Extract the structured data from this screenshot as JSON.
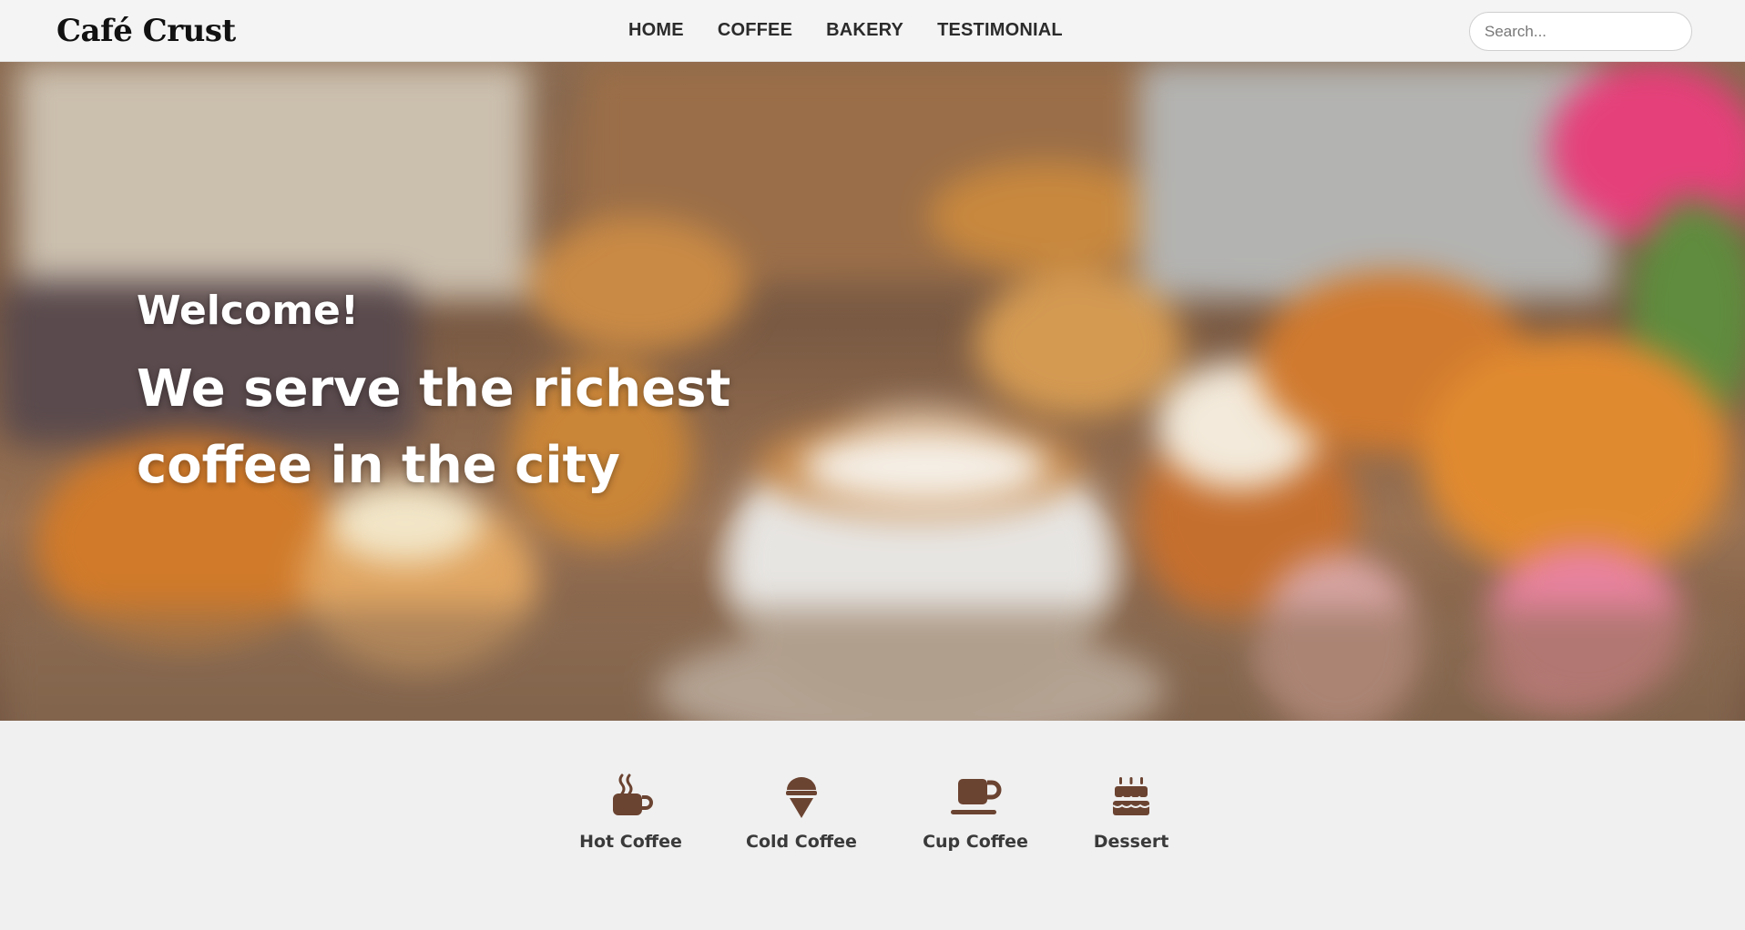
{
  "brand": {
    "name": "Café Crust"
  },
  "nav": {
    "links": [
      {
        "label": "HOME"
      },
      {
        "label": "COFFEE"
      },
      {
        "label": "BAKERY"
      },
      {
        "label": "TESTIMONIAL"
      }
    ]
  },
  "search": {
    "placeholder": "Search...",
    "value": ""
  },
  "hero": {
    "welcome": "Welcome!",
    "tagline": "We serve the richest coffee in the city"
  },
  "categories": [
    {
      "label": "Hot Coffee",
      "icon": "hot-coffee-icon"
    },
    {
      "label": "Cold Coffee",
      "icon": "ice-cream-cone-icon"
    },
    {
      "label": "Cup Coffee",
      "icon": "coffee-cup-icon"
    },
    {
      "label": "Dessert",
      "icon": "birthday-cake-icon"
    }
  ],
  "colors": {
    "icon_brown": "#6b4331",
    "nav_bg": "#f4f4f4",
    "page_bg": "#f0f0f0"
  }
}
